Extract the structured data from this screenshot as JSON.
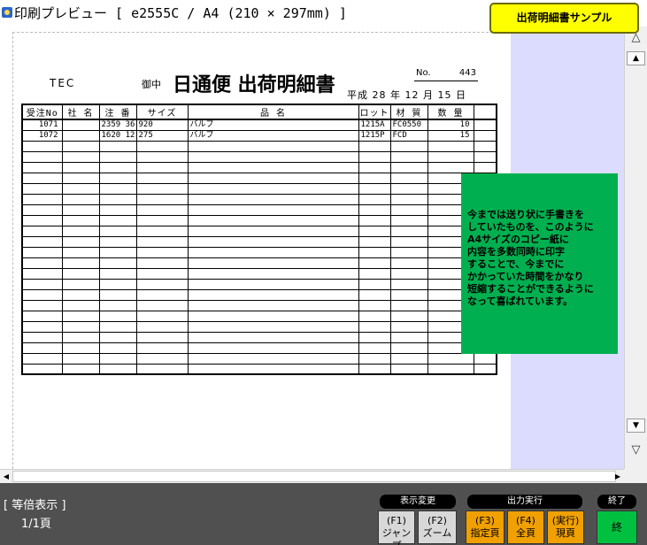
{
  "window": {
    "title": "印刷プレビュー [ e2555C / A4 (210 × 297mm) ]"
  },
  "badge": {
    "text": "出荷明細書サンプル"
  },
  "document": {
    "company": "TEC",
    "honorific": "御中",
    "title": "日通便 出荷明細書",
    "no_label": "No.",
    "no_value": "443",
    "date": "平成 28 年 12 月 15 日",
    "columns": [
      "受注No",
      "社 名",
      "注 番",
      "サイズ",
      "品 名",
      "ロット",
      "材 質",
      "数 量",
      ""
    ],
    "rows": [
      [
        "1071",
        "",
        "2359 36",
        "920",
        "バルブ",
        "1215A",
        "FC0550",
        "10",
        ""
      ],
      [
        "1072",
        "",
        "1620 12",
        "275",
        "バルブ",
        "1215P",
        "FCD",
        "15",
        ""
      ]
    ]
  },
  "note": {
    "lines": [
      "今までは送り状に手書きを",
      "していたものを、このように",
      "A4サイズのコピー紙に",
      "内容を多数同時に印字",
      "することで、今までに",
      "かかっていた時間をかなり",
      "短縮することができるように",
      "なって喜ばれています。"
    ]
  },
  "status": {
    "mode": "[ 等倍表示 ]",
    "page": "1/1頁"
  },
  "groups": {
    "display_change": "表示変更",
    "output": "出力実行",
    "exit": "終了"
  },
  "buttons": {
    "jump": {
      "key": "(F1)",
      "label": "ジャンプ"
    },
    "zoom": {
      "key": "(F2)",
      "label": "ズーム"
    },
    "specified": {
      "key": "(F3)",
      "label": "指定頁"
    },
    "all": {
      "key": "(F4)",
      "label": "全頁"
    },
    "current": {
      "key": "(実行)",
      "label": "現頁"
    },
    "end": {
      "label": "終"
    }
  },
  "colors": {
    "badge": "#ffff00",
    "note": "#00b050",
    "orange_button": "#f0a000",
    "end_button": "#00c040",
    "side_panel": "#dcdcff"
  }
}
